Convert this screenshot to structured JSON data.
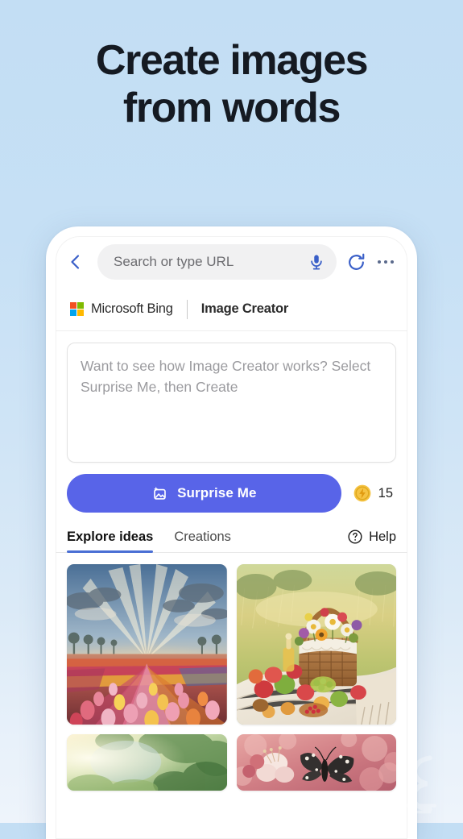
{
  "page": {
    "headline_line1": "Create images",
    "headline_line2": "from words",
    "background_top": "#c3def4",
    "background_bottom": "#eef4fb"
  },
  "browser": {
    "back_icon": "chevron-left-icon",
    "url_placeholder": "Search or type URL",
    "mic_icon": "microphone-icon",
    "reload_icon": "reload-icon",
    "more_icon": "more-horizontal-icon",
    "accent": "#3a5fc8"
  },
  "site_header": {
    "logo_icon": "microsoft-logo-icon",
    "brand": "Microsoft Bing",
    "product": "Image Creator",
    "logo_colors": {
      "top_left": "#f25022",
      "top_right": "#7fba00",
      "bottom_left": "#00a4ef",
      "bottom_right": "#ffb900"
    }
  },
  "prompt": {
    "placeholder": "Want to see how Image Creator works? Select Surprise Me, then Create",
    "value": ""
  },
  "actions": {
    "surprise_label": "Surprise Me",
    "surprise_icon": "image-sparkle-icon",
    "surprise_color": "#5864e8",
    "token_icon": "boost-coin-icon",
    "token_count": "15",
    "token_color": "#f5c343"
  },
  "tabs": {
    "items": [
      {
        "label": "Explore ideas",
        "active": true
      },
      {
        "label": "Creations",
        "active": false
      }
    ],
    "active_underline_color": "#4a6fd4",
    "help_icon": "question-circle-icon",
    "help_label": "Help"
  },
  "gallery": {
    "tiles": [
      {
        "name": "tulip-field-sunrise",
        "alt": "Tulip field at sunrise with sun rays"
      },
      {
        "name": "picnic-basket-flowers",
        "alt": "Picnic basket with wildflowers and fruit in a meadow"
      },
      {
        "name": "sunlit-forest",
        "alt": "Sunlit green forest with light beams"
      },
      {
        "name": "butterfly-blossoms",
        "alt": "Butterfly on pink blossoms"
      }
    ]
  },
  "watermark": {
    "name": "corner-watermark"
  }
}
